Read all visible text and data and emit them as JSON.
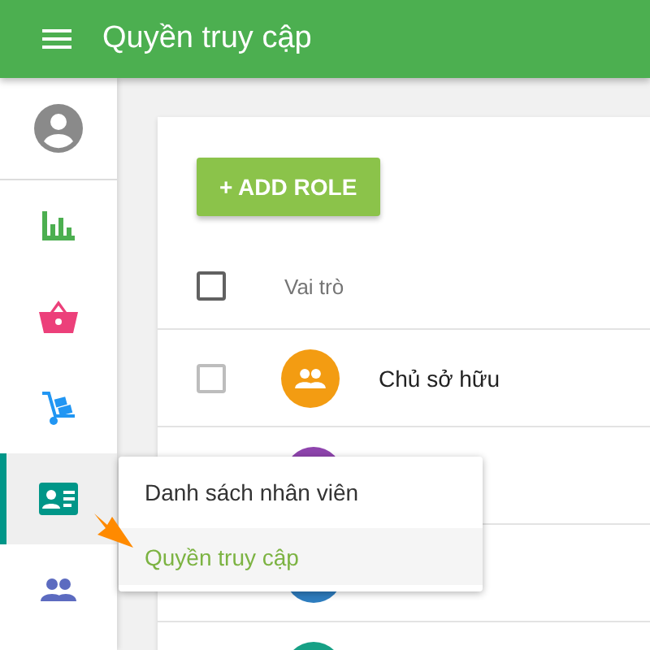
{
  "app_bar": {
    "title": "Quyền truy cập"
  },
  "sidebar": {
    "items": [
      {
        "selected": false
      },
      {
        "selected": false
      },
      {
        "selected": false
      },
      {
        "selected": true
      },
      {
        "selected": false
      }
    ]
  },
  "add_button": {
    "label": "+ ADD ROLE"
  },
  "table": {
    "header": {
      "checked": false,
      "label": "Vai trò"
    },
    "rows": [
      {
        "checked": false,
        "color": "#f39c12",
        "name": "Chủ sở hữu"
      },
      {
        "color": "#8e44ad"
      },
      {
        "color": "#2e7dbf"
      },
      {
        "color": "#16a085"
      }
    ]
  },
  "popup_menu": {
    "items": [
      {
        "label": "Danh sách nhân viên",
        "selected": false
      },
      {
        "label": "Quyền truy cập",
        "selected": true
      }
    ]
  }
}
